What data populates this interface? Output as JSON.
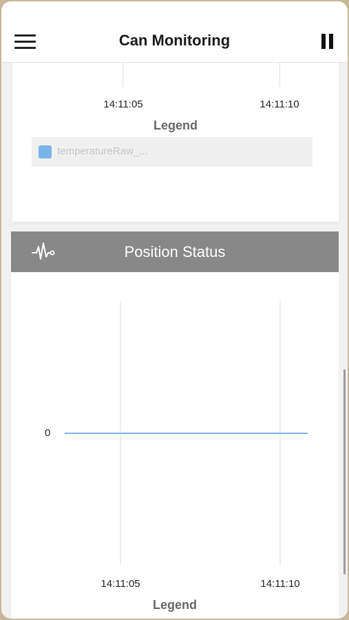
{
  "navbar": {
    "title": "Can Monitoring",
    "menu_icon": "hamburger-menu-icon",
    "pause_icon": "pause-icon"
  },
  "top_chart": {
    "x_ticks": [
      "14:11:05",
      "14:11:10"
    ],
    "legend_title": "Legend",
    "legend_items": [
      {
        "label": "temperatureRaw_...",
        "color": "#7ab3e8"
      }
    ]
  },
  "position_panel": {
    "title": "Position Status",
    "icon": "pulse-icon"
  },
  "chart_data": {
    "type": "line",
    "x": [
      "14:11:04",
      "14:11:05",
      "14:11:10",
      "14:11:11"
    ],
    "series": [
      {
        "values": [
          0,
          0,
          0,
          0
        ],
        "color": "#7ab3e8"
      }
    ],
    "x_ticks": [
      "14:11:05",
      "14:11:10"
    ],
    "y_ticks": [
      "0"
    ],
    "legend_title": "Legend"
  }
}
